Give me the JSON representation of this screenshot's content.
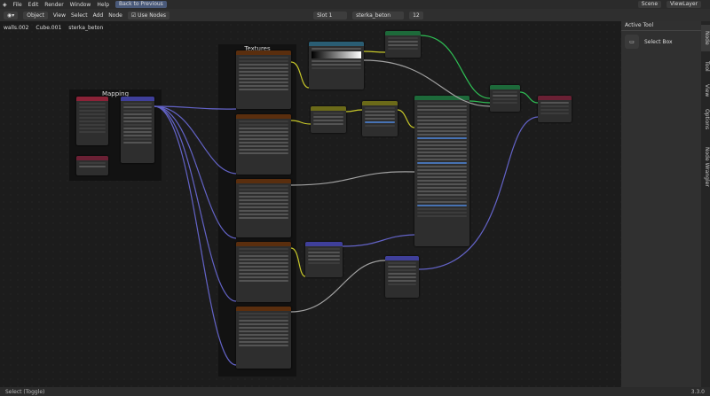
{
  "topbar": {
    "menus": [
      "File",
      "Edit",
      "Render",
      "Window",
      "Help"
    ],
    "back_button": "Back to Previous",
    "scene": "Scene",
    "view_layer": "ViewLayer"
  },
  "header": {
    "mode": "Object",
    "menus": [
      "View",
      "Select",
      "Add",
      "Node"
    ],
    "use_nodes": "Use Nodes",
    "slot": "Slot 1",
    "material": "sterka_beton",
    "users": "12"
  },
  "breadcrumb": [
    "walls.002",
    "Cube.001",
    "sterka_beton"
  ],
  "frames": {
    "mapping": "Mapping",
    "textures": "Textures"
  },
  "sidebar": {
    "header": "Active Tool",
    "tool": "Select Box",
    "tabs": [
      "Node",
      "Tool",
      "View",
      "Options",
      "Node Wrangler"
    ]
  },
  "statusbar": {
    "left": "Select (Toggle)",
    "right": "3.3.0"
  }
}
